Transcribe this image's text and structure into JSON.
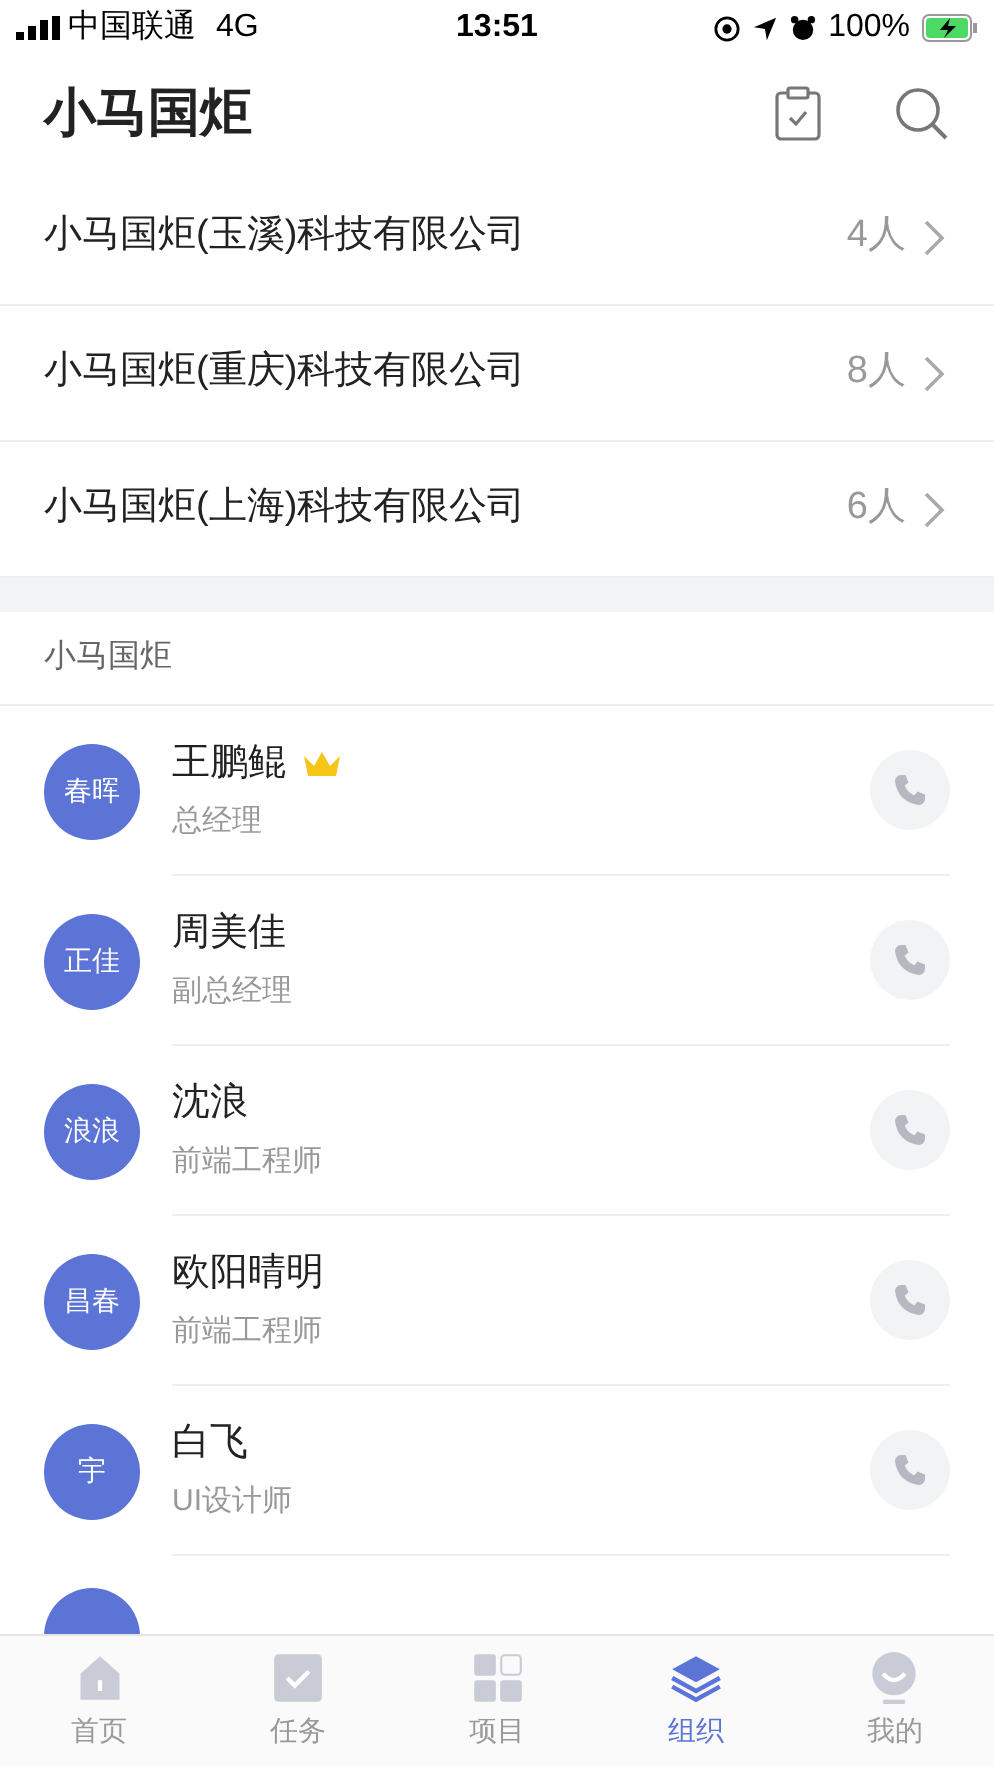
{
  "status_bar": {
    "carrier": "中国联通",
    "network": "4G",
    "time": "13:51",
    "battery": "100%"
  },
  "header": {
    "title": "小马国炬"
  },
  "companies": [
    {
      "name": "小马国炬(玉溪)科技有限公司",
      "count": "4人"
    },
    {
      "name": "小马国炬(重庆)科技有限公司",
      "count": "8人"
    },
    {
      "name": "小马国炬(上海)科技有限公司",
      "count": "6人"
    }
  ],
  "section": {
    "title": "小马国炬"
  },
  "members": [
    {
      "avatar": "春晖",
      "name": "王鹏鲲",
      "role": "总经理",
      "leader": true
    },
    {
      "avatar": "正佳",
      "name": "周美佳",
      "role": "副总经理",
      "leader": false
    },
    {
      "avatar": "浪浪",
      "name": "沈浪",
      "role": "前端工程师",
      "leader": false
    },
    {
      "avatar": "昌春",
      "name": "欧阳晴明",
      "role": "前端工程师",
      "leader": false
    },
    {
      "avatar": "宇",
      "name": "白飞",
      "role": "UI设计师",
      "leader": false
    }
  ],
  "tabs": [
    {
      "kind": "home",
      "label": "首页",
      "selected": false
    },
    {
      "kind": "task",
      "label": "任务",
      "selected": false
    },
    {
      "kind": "project",
      "label": "项目",
      "selected": false
    },
    {
      "kind": "org",
      "label": "组织",
      "selected": true
    },
    {
      "kind": "me",
      "label": "我的",
      "selected": false
    }
  ]
}
